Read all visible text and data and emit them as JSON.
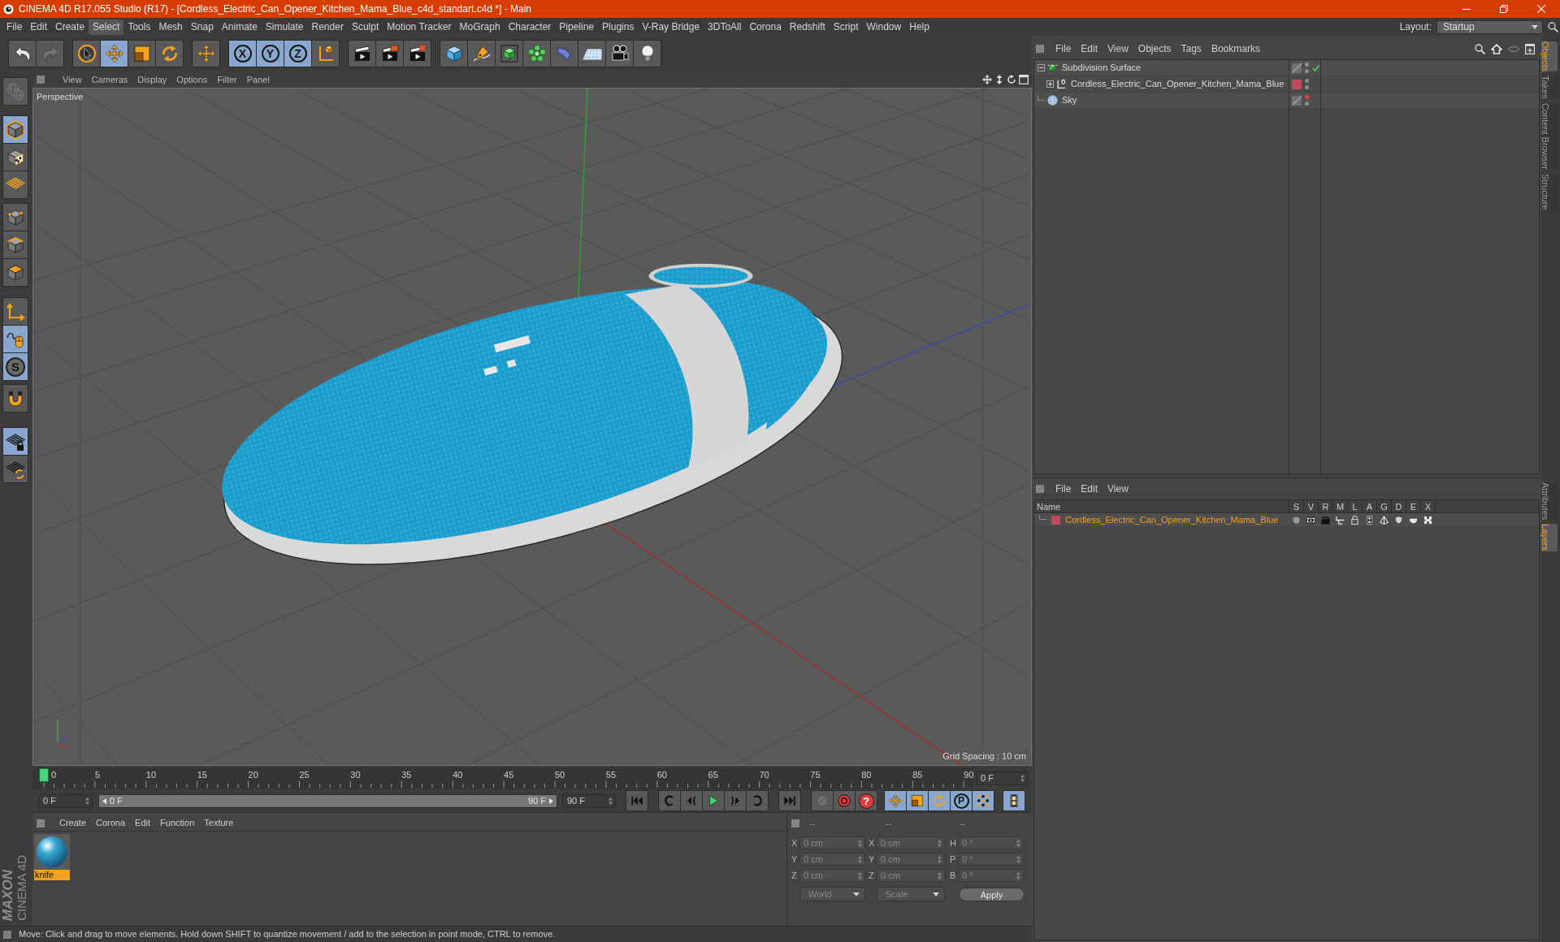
{
  "window": {
    "title": "CINEMA 4D R17.055 Studio (R17) - [Cordless_Electric_Can_Opener_Kitchen_Mama_Blue_c4d_standart.c4d *] - Main"
  },
  "menu_bar": {
    "items": [
      {
        "label": "File",
        "selected": false
      },
      {
        "label": "Edit",
        "selected": false
      },
      {
        "label": "Create",
        "selected": false
      },
      {
        "label": "Select",
        "selected": true
      },
      {
        "label": "Tools",
        "selected": false
      },
      {
        "label": "Mesh",
        "selected": false
      },
      {
        "label": "Snap",
        "selected": false
      },
      {
        "label": "Animate",
        "selected": false
      },
      {
        "label": "Simulate",
        "selected": false
      },
      {
        "label": "Render",
        "selected": false
      },
      {
        "label": "Sculpt",
        "selected": false
      },
      {
        "label": "Motion Tracker",
        "selected": false
      },
      {
        "label": "MoGraph",
        "selected": false
      },
      {
        "label": "Character",
        "selected": false
      },
      {
        "label": "Pipeline",
        "selected": false
      },
      {
        "label": "Plugins",
        "selected": false
      },
      {
        "label": "V-Ray Bridge",
        "selected": false
      },
      {
        "label": "3DToAll",
        "selected": false
      },
      {
        "label": "Corona",
        "selected": false
      },
      {
        "label": "Redshift",
        "selected": false
      },
      {
        "label": "Script",
        "selected": false
      },
      {
        "label": "Window",
        "selected": false
      },
      {
        "label": "Help",
        "selected": false
      }
    ],
    "layout_label": "Layout:",
    "layout_value": "Startup"
  },
  "toolbar": {
    "groups": [
      [
        {
          "kind": "undo",
          "on": false,
          "disabled": false
        },
        {
          "kind": "redo",
          "on": false,
          "disabled": true
        }
      ],
      [
        {
          "kind": "select",
          "on": false,
          "disabled": false
        },
        {
          "kind": "move",
          "on": true,
          "disabled": false
        },
        {
          "kind": "scale",
          "on": false,
          "disabled": false
        },
        {
          "kind": "rotate",
          "on": false,
          "disabled": false
        }
      ],
      [
        {
          "kind": "live_move",
          "on": false,
          "disabled": false
        }
      ],
      [
        {
          "kind": "axis_x",
          "label": "X",
          "on": true,
          "disabled": false
        },
        {
          "kind": "axis_y",
          "label": "Y",
          "on": true,
          "disabled": false
        },
        {
          "kind": "axis_z",
          "label": "Z",
          "on": true,
          "disabled": false
        },
        {
          "kind": "coords",
          "on": false,
          "disabled": false
        }
      ],
      [
        {
          "kind": "render_view",
          "on": false,
          "disabled": false
        },
        {
          "kind": "render_viewer",
          "on": false,
          "disabled": false
        },
        {
          "kind": "render_settings",
          "on": false,
          "disabled": false
        }
      ],
      [
        {
          "kind": "cube",
          "on": false,
          "disabled": false
        },
        {
          "kind": "pen",
          "on": false,
          "disabled": false
        },
        {
          "kind": "subdivision",
          "on": false,
          "disabled": false
        },
        {
          "kind": "cloner",
          "on": false,
          "disabled": false
        },
        {
          "kind": "deformer",
          "on": false,
          "disabled": false
        },
        {
          "kind": "floor",
          "on": false,
          "disabled": false
        },
        {
          "kind": "camera",
          "on": false,
          "disabled": false
        },
        {
          "kind": "light",
          "on": false,
          "disabled": false
        }
      ]
    ]
  },
  "tool_strip": {
    "groups": [
      [
        {
          "kind": "world",
          "on": false,
          "disabled": true
        }
      ],
      [
        {
          "kind": "model",
          "on": true,
          "disabled": false
        },
        {
          "kind": "texture",
          "on": false,
          "disabled": false
        },
        {
          "kind": "workplane",
          "on": false,
          "disabled": false
        }
      ],
      [
        {
          "kind": "points",
          "on": false,
          "disabled": false
        },
        {
          "kind": "edges",
          "on": false,
          "disabled": false
        },
        {
          "kind": "polygons",
          "on": false,
          "disabled": false
        }
      ],
      [
        {
          "kind": "axis",
          "on": false,
          "disabled": false
        },
        {
          "kind": "tweak",
          "on": true,
          "disabled": false
        },
        {
          "kind": "snap",
          "label": "S",
          "on": true,
          "disabled": false
        }
      ],
      [
        {
          "kind": "magnet",
          "on": false,
          "disabled": false
        }
      ],
      [
        {
          "kind": "grid_lock",
          "on": true,
          "disabled": false
        },
        {
          "kind": "grid_refresh",
          "on": false,
          "disabled": false
        }
      ]
    ]
  },
  "logo": {
    "wordmark": "MAXON",
    "product": "CINEMA 4D"
  },
  "viewport": {
    "menu": [
      "View",
      "Cameras",
      "Display",
      "Options",
      "Filter",
      "Panel"
    ],
    "camera": "Perspective",
    "grid_spacing": "Grid Spacing : 10 cm"
  },
  "timeline": {
    "ticks": [
      "0",
      "5",
      "10",
      "15",
      "20",
      "25",
      "30",
      "35",
      "40",
      "45",
      "50",
      "55",
      "60",
      "65",
      "70",
      "75",
      "80",
      "85",
      "90"
    ],
    "playhead": {
      "level": 0
    },
    "current_frame": "0 F",
    "start_frame": "0 F",
    "range": {
      "start": "0 F",
      "end": "90 F"
    },
    "end_frame": "90 F",
    "control_groups": [
      [
        {
          "kind": "go_start",
          "on": false,
          "disabled": false
        }
      ],
      [
        {
          "kind": "prev_key",
          "on": false,
          "disabled": false
        },
        {
          "kind": "prev_frame",
          "on": false,
          "disabled": false
        },
        {
          "kind": "play",
          "on": false,
          "disabled": false
        },
        {
          "kind": "next_frame",
          "on": false,
          "disabled": false
        },
        {
          "kind": "next_key",
          "on": false,
          "disabled": false
        }
      ],
      [
        {
          "kind": "go_end",
          "on": false,
          "disabled": false
        }
      ],
      [
        {
          "kind": "key",
          "on": false,
          "disabled": true
        },
        {
          "kind": "record",
          "on": false,
          "disabled": false
        },
        {
          "kind": "autokey",
          "label": "?",
          "on": false,
          "disabled": false
        }
      ],
      [
        {
          "kind": "key_move",
          "on": true,
          "disabled": false
        },
        {
          "kind": "key_scale",
          "on": true,
          "disabled": false
        },
        {
          "kind": "key_rotate",
          "on": true,
          "disabled": false
        },
        {
          "kind": "param",
          "label": "P",
          "on": true,
          "disabled": false
        },
        {
          "kind": "pla",
          "on": true,
          "disabled": false
        }
      ],
      [
        {
          "kind": "film",
          "on": true,
          "disabled": false
        }
      ]
    ]
  },
  "material_manager": {
    "menu": [
      "Create",
      "Corona",
      "Edit",
      "Function",
      "Texture"
    ],
    "materials": [
      {
        "name": "knife",
        "selected": true
      }
    ]
  },
  "coordinates": {
    "headers": [
      "--",
      "--",
      "--"
    ],
    "rows": [
      [
        {
          "axis": "X",
          "value": "0 cm"
        },
        {
          "axis": "X",
          "value": "0 cm"
        },
        {
          "axis": "H",
          "value": "0 °"
        }
      ],
      [
        {
          "axis": "Y",
          "value": "0 cm"
        },
        {
          "axis": "Y",
          "value": "0 cm"
        },
        {
          "axis": "P",
          "value": "0 °"
        }
      ],
      [
        {
          "axis": "Z",
          "value": "0 cm"
        },
        {
          "axis": "Z",
          "value": "0 cm"
        },
        {
          "axis": "B",
          "value": "0 °"
        }
      ]
    ],
    "mode": {
      "value": "World",
      "disabled": true
    },
    "size_mode": {
      "value": "Scale",
      "disabled": true
    },
    "apply": "Apply"
  },
  "status_bar": {
    "text": "Move: Click and drag to move elements. Hold down SHIFT to quantize movement / add to the selection in point mode, CTRL to remove."
  },
  "object_manager": {
    "menu": [
      "File",
      "Edit",
      "View",
      "Objects",
      "Tags",
      "Bookmarks"
    ],
    "objects": [
      {
        "name": "Subdivision Surface",
        "kind": "subdivision",
        "expanded": true,
        "hidden_in_editor": false,
        "hidden_in_render": false,
        "enabled": true,
        "children": [
          {
            "name": "Cordless_Electric_Can_Opener_Kitchen_Mama_Blue",
            "kind": "null",
            "expanded": false,
            "color": "#c4475f",
            "hidden_in_editor": false,
            "hidden_in_render": false
          }
        ]
      },
      {
        "name": "Sky",
        "kind": "sky",
        "hidden_in_editor": true,
        "hidden_in_render": false
      }
    ]
  },
  "layer_manager": {
    "menu": [
      "File",
      "Edit",
      "View"
    ],
    "columns": [
      "Name",
      "S",
      "V",
      "R",
      "M",
      "L",
      "A",
      "G",
      "D",
      "E",
      "X"
    ],
    "layers": [
      {
        "name": "Cordless_Electric_Can_Opener_Kitchen_Mama_Blue",
        "color": "#c4475f",
        "selected": true
      }
    ]
  },
  "dock_tabs": {
    "top": [
      {
        "label": "Objects",
        "selected": true
      },
      {
        "label": "Takes",
        "selected": false
      },
      {
        "label": "Content Browser",
        "selected": false
      },
      {
        "label": "Structure",
        "selected": false
      }
    ],
    "bottom": [
      {
        "label": "Attributes",
        "selected": false
      },
      {
        "label": "Layers",
        "selected": true
      }
    ]
  }
}
